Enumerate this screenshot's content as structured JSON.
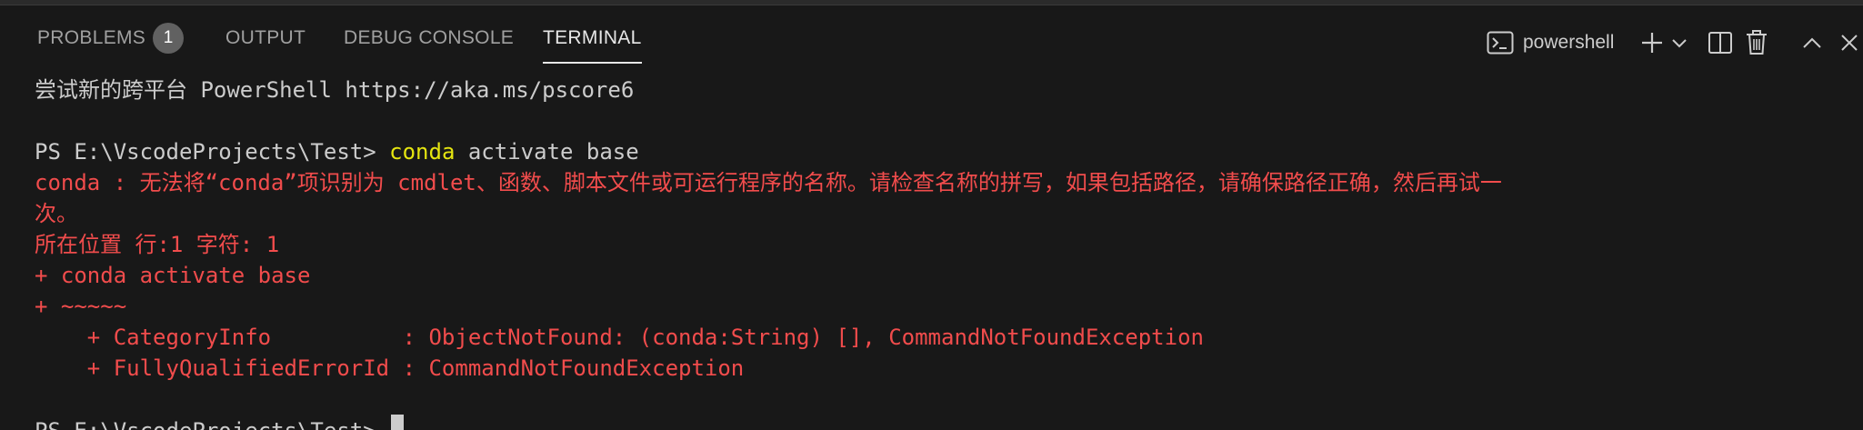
{
  "tabs": {
    "problems": "PROBLEMS",
    "problems_count": "1",
    "output": "OUTPUT",
    "debug_console": "DEBUG CONSOLE",
    "terminal": "TERMINAL"
  },
  "terminal_actions": {
    "shell_name": "powershell",
    "icons": [
      "terminal-icon",
      "plus-icon",
      "chevron-down-icon",
      "split-icon",
      "trash-icon",
      "chevron-up-icon",
      "close-icon"
    ]
  },
  "terminal": {
    "line1": "尝试新的跨平台 PowerShell https://aka.ms/pscore6",
    "prompt1": "PS E:\\VscodeProjects\\Test> ",
    "cmd_word": "conda",
    "cmd_rest": " activate base",
    "err1": "conda : 无法将“conda”项识别为 cmdlet、函数、脚本文件或可运行程序的名称。请检查名称的拼写，如果包括路径，请确保路径正确，然后再试一",
    "err2": "次。",
    "err3": "所在位置 行:1 字符: 1",
    "err4": "+ conda activate base",
    "err5": "+ ~~~~~",
    "err6": "    + CategoryInfo          : ObjectNotFound: (conda:String) [], CommandNotFoundException",
    "err7": "    + FullyQualifiedErrorId : CommandNotFoundException",
    "prompt2": "PS E:\\VscodeProjects\\Test> "
  },
  "colors": {
    "background": "#181818",
    "error": "#f14c4c",
    "command": "#e5e510",
    "text": "#cccccc"
  }
}
